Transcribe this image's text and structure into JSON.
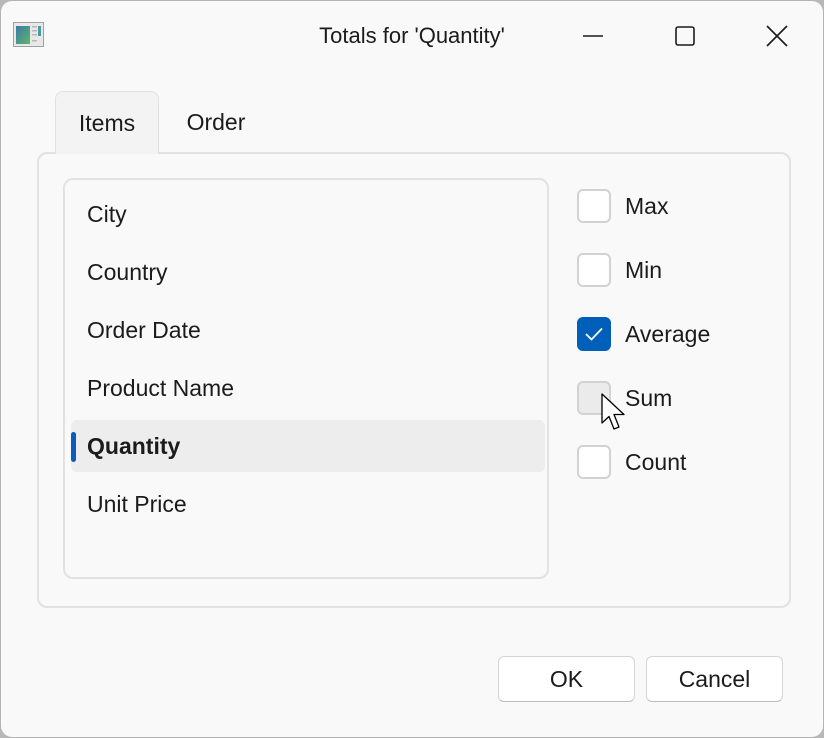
{
  "window": {
    "title": "Totals for 'Quantity'",
    "app_icon": "table-app-icon",
    "controls": [
      "minimize-icon",
      "maximize-icon",
      "close-icon"
    ]
  },
  "tabs": [
    {
      "label": "Items",
      "active": true
    },
    {
      "label": "Order",
      "active": false
    }
  ],
  "fields": [
    {
      "label": "City",
      "selected": false
    },
    {
      "label": "Country",
      "selected": false
    },
    {
      "label": "Order Date",
      "selected": false
    },
    {
      "label": "Product Name",
      "selected": false
    },
    {
      "label": "Quantity",
      "selected": true
    },
    {
      "label": "Unit Price",
      "selected": false
    }
  ],
  "totals": [
    {
      "label": "Max",
      "checked": false
    },
    {
      "label": "Min",
      "checked": false
    },
    {
      "label": "Average",
      "checked": true
    },
    {
      "label": "Sum",
      "checked": false,
      "hovered": true
    },
    {
      "label": "Count",
      "checked": false
    }
  ],
  "buttons": {
    "ok": "OK",
    "cancel": "Cancel"
  },
  "colors": {
    "accent": "#005fb8",
    "selection_indicator": "#0a5cbf"
  }
}
